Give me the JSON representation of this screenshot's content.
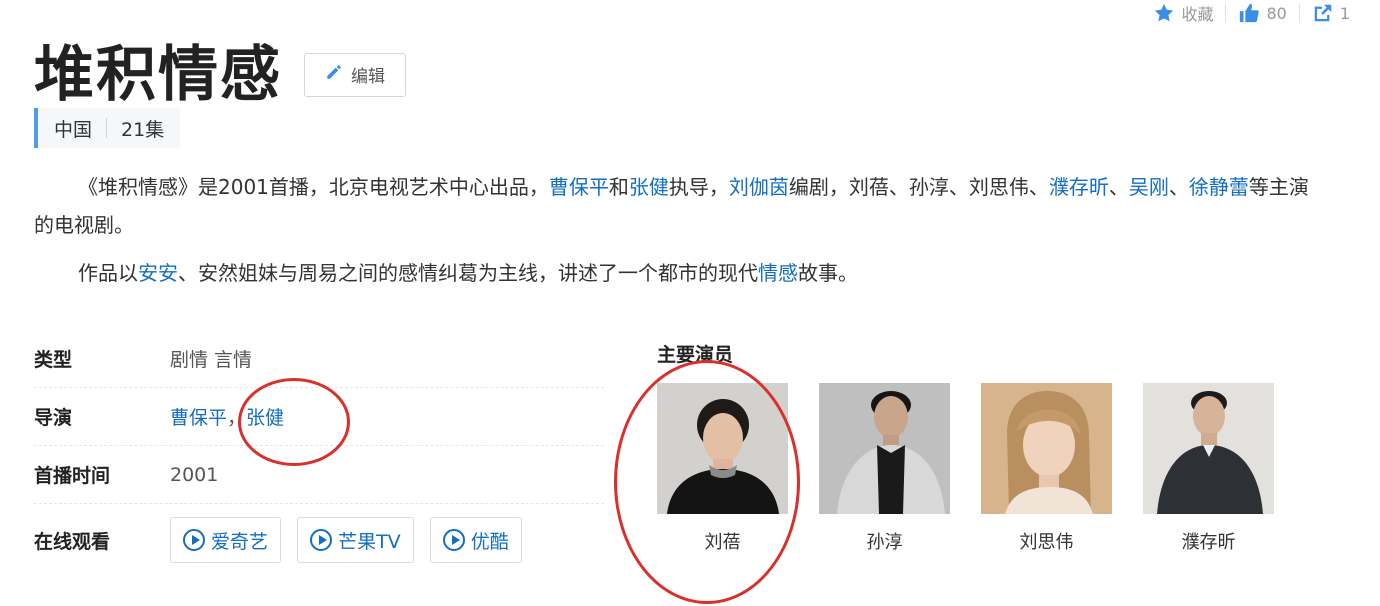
{
  "toolbar": {
    "collect_label": "收藏",
    "like_count": "80",
    "share_count": "1"
  },
  "title": "堆积情感",
  "edit_label": "编辑",
  "meta": {
    "country": "中国",
    "episodes": "21集"
  },
  "intro": {
    "p1": [
      {
        "t": "《堆积情感》是2001首播，北京电视艺术中心出品，"
      },
      {
        "t": "曹保平",
        "link": true
      },
      {
        "t": "和"
      },
      {
        "t": "张健",
        "link": true
      },
      {
        "t": "执导，"
      },
      {
        "t": "刘伽茵",
        "link": true
      },
      {
        "t": "编剧，刘蓓、孙淳、刘思伟、"
      },
      {
        "t": "濮存昕",
        "link": true
      },
      {
        "t": "、"
      },
      {
        "t": "吴刚",
        "link": true
      },
      {
        "t": "、"
      },
      {
        "t": "徐静蕾",
        "link": true
      },
      {
        "t": "等主演的电视剧。"
      }
    ],
    "p2": [
      {
        "t": "作品以"
      },
      {
        "t": "安安",
        "link": true
      },
      {
        "t": "、安然姐妹与周易之间的感情纠葛为主线，讲述了一个都市的现代"
      },
      {
        "t": "情感",
        "link": true
      },
      {
        "t": "故事。"
      }
    ]
  },
  "info": {
    "type_label": "类型",
    "type_value": "剧情 言情",
    "director_label": "导演",
    "director_1": "曹保平",
    "director_sep": "，",
    "director_2": "张健",
    "premiere_label": "首播时间",
    "premiere_value": "2001",
    "watch_label": "在线观看",
    "watch_options": [
      "爱奇艺",
      "芒果TV",
      "优酷"
    ]
  },
  "cast": {
    "title": "主要演员",
    "members": [
      {
        "name": "刘蓓"
      },
      {
        "name": "孙淳"
      },
      {
        "name": "刘思伟"
      },
      {
        "name": "濮存昕"
      }
    ]
  },
  "colors": {
    "link": "#136ec2",
    "accent_bar": "#4f9cee",
    "annotation": "#d9302b",
    "toolbar_icon": "#3b8ee8"
  }
}
